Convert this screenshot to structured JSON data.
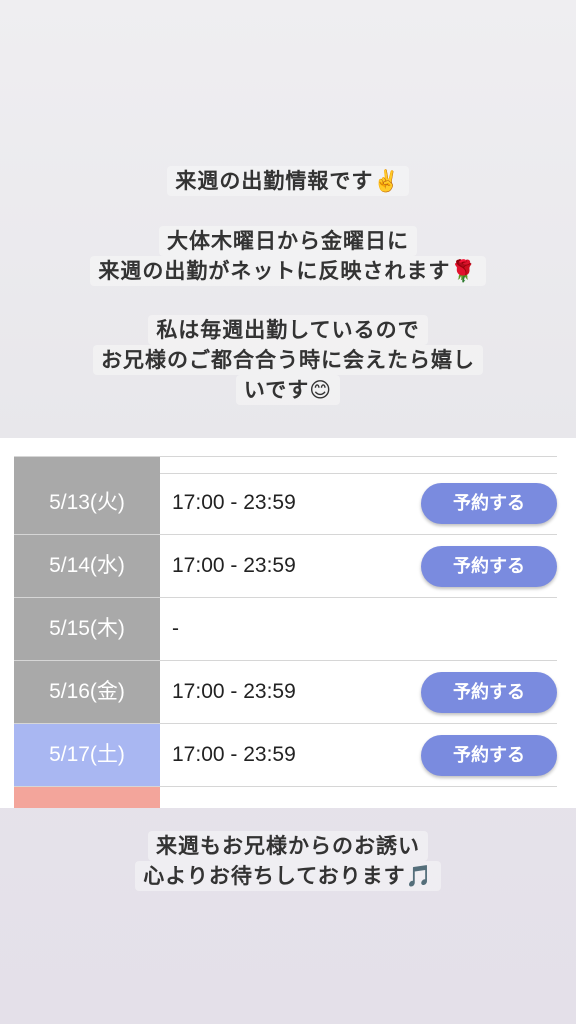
{
  "intro": {
    "line1": "来週の出勤情報です✌️",
    "line2": "大体木曜日から金曜日に",
    "line3": "来週の出勤がネットに反映されます🌹",
    "line4": "私は毎週出勤しているので",
    "line5": "お兄様のご都合合う時に会えたら嬉し",
    "line6": "いです😊"
  },
  "schedule": {
    "rows": [
      {
        "date": "5/13(火)",
        "time": "17:00 - 23:59",
        "button": "予約する"
      },
      {
        "date": "5/14(水)",
        "time": "17:00 - 23:59",
        "button": "予約する"
      },
      {
        "date": "5/15(木)",
        "time": "-",
        "button": ""
      },
      {
        "date": "5/16(金)",
        "time": "17:00 - 23:59",
        "button": "予約する"
      },
      {
        "date": "5/17(土)",
        "time": "17:00 - 23:59",
        "button": "予約する"
      }
    ]
  },
  "outro": {
    "line1": "来週もお兄様からのお誘い",
    "line2": "心よりお待ちしております🎵"
  },
  "colors": {
    "date_cell_gray": "#a9a9a9",
    "date_cell_saturday": "#a9b7f2",
    "date_cell_sunday": "#f3a59b",
    "reserve_button": "#7a8bdf"
  }
}
